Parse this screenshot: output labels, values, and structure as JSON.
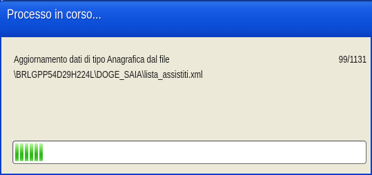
{
  "window": {
    "title": "Processo in corso..."
  },
  "message": {
    "line1": "Aggiornamento dati di tipo Anagrafica dal file",
    "line2": "\\BRLGPP54D29H224L\\DOGE_SAIA\\lista_assistiti.xml"
  },
  "progress": {
    "counter_text": "99/1131",
    "current": 99,
    "total": 1131,
    "fraction": 0.0875
  },
  "colors": {
    "titlebar": "#0f53dc",
    "window_bg": "#ece9d8",
    "progress_green": "#2fb61a"
  }
}
